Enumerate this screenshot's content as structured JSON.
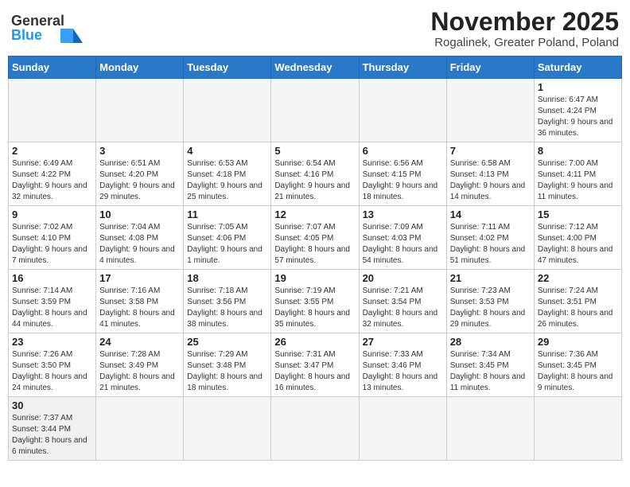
{
  "header": {
    "logo_general": "General",
    "logo_blue": "Blue",
    "month_title": "November 2025",
    "location": "Rogalinek, Greater Poland, Poland"
  },
  "days_of_week": [
    "Sunday",
    "Monday",
    "Tuesday",
    "Wednesday",
    "Thursday",
    "Friday",
    "Saturday"
  ],
  "weeks": [
    [
      {
        "day": "",
        "info": ""
      },
      {
        "day": "",
        "info": ""
      },
      {
        "day": "",
        "info": ""
      },
      {
        "day": "",
        "info": ""
      },
      {
        "day": "",
        "info": ""
      },
      {
        "day": "",
        "info": ""
      },
      {
        "day": "1",
        "info": "Sunrise: 6:47 AM\nSunset: 4:24 PM\nDaylight: 9 hours\nand 36 minutes."
      }
    ],
    [
      {
        "day": "2",
        "info": "Sunrise: 6:49 AM\nSunset: 4:22 PM\nDaylight: 9 hours\nand 32 minutes."
      },
      {
        "day": "3",
        "info": "Sunrise: 6:51 AM\nSunset: 4:20 PM\nDaylight: 9 hours\nand 29 minutes."
      },
      {
        "day": "4",
        "info": "Sunrise: 6:53 AM\nSunset: 4:18 PM\nDaylight: 9 hours\nand 25 minutes."
      },
      {
        "day": "5",
        "info": "Sunrise: 6:54 AM\nSunset: 4:16 PM\nDaylight: 9 hours\nand 21 minutes."
      },
      {
        "day": "6",
        "info": "Sunrise: 6:56 AM\nSunset: 4:15 PM\nDaylight: 9 hours\nand 18 minutes."
      },
      {
        "day": "7",
        "info": "Sunrise: 6:58 AM\nSunset: 4:13 PM\nDaylight: 9 hours\nand 14 minutes."
      },
      {
        "day": "8",
        "info": "Sunrise: 7:00 AM\nSunset: 4:11 PM\nDaylight: 9 hours\nand 11 minutes."
      }
    ],
    [
      {
        "day": "9",
        "info": "Sunrise: 7:02 AM\nSunset: 4:10 PM\nDaylight: 9 hours\nand 7 minutes."
      },
      {
        "day": "10",
        "info": "Sunrise: 7:04 AM\nSunset: 4:08 PM\nDaylight: 9 hours\nand 4 minutes."
      },
      {
        "day": "11",
        "info": "Sunrise: 7:05 AM\nSunset: 4:06 PM\nDaylight: 9 hours\nand 1 minute."
      },
      {
        "day": "12",
        "info": "Sunrise: 7:07 AM\nSunset: 4:05 PM\nDaylight: 8 hours\nand 57 minutes."
      },
      {
        "day": "13",
        "info": "Sunrise: 7:09 AM\nSunset: 4:03 PM\nDaylight: 8 hours\nand 54 minutes."
      },
      {
        "day": "14",
        "info": "Sunrise: 7:11 AM\nSunset: 4:02 PM\nDaylight: 8 hours\nand 51 minutes."
      },
      {
        "day": "15",
        "info": "Sunrise: 7:12 AM\nSunset: 4:00 PM\nDaylight: 8 hours\nand 47 minutes."
      }
    ],
    [
      {
        "day": "16",
        "info": "Sunrise: 7:14 AM\nSunset: 3:59 PM\nDaylight: 8 hours\nand 44 minutes."
      },
      {
        "day": "17",
        "info": "Sunrise: 7:16 AM\nSunset: 3:58 PM\nDaylight: 8 hours\nand 41 minutes."
      },
      {
        "day": "18",
        "info": "Sunrise: 7:18 AM\nSunset: 3:56 PM\nDaylight: 8 hours\nand 38 minutes."
      },
      {
        "day": "19",
        "info": "Sunrise: 7:19 AM\nSunset: 3:55 PM\nDaylight: 8 hours\nand 35 minutes."
      },
      {
        "day": "20",
        "info": "Sunrise: 7:21 AM\nSunset: 3:54 PM\nDaylight: 8 hours\nand 32 minutes."
      },
      {
        "day": "21",
        "info": "Sunrise: 7:23 AM\nSunset: 3:53 PM\nDaylight: 8 hours\nand 29 minutes."
      },
      {
        "day": "22",
        "info": "Sunrise: 7:24 AM\nSunset: 3:51 PM\nDaylight: 8 hours\nand 26 minutes."
      }
    ],
    [
      {
        "day": "23",
        "info": "Sunrise: 7:26 AM\nSunset: 3:50 PM\nDaylight: 8 hours\nand 24 minutes."
      },
      {
        "day": "24",
        "info": "Sunrise: 7:28 AM\nSunset: 3:49 PM\nDaylight: 8 hours\nand 21 minutes."
      },
      {
        "day": "25",
        "info": "Sunrise: 7:29 AM\nSunset: 3:48 PM\nDaylight: 8 hours\nand 18 minutes."
      },
      {
        "day": "26",
        "info": "Sunrise: 7:31 AM\nSunset: 3:47 PM\nDaylight: 8 hours\nand 16 minutes."
      },
      {
        "day": "27",
        "info": "Sunrise: 7:33 AM\nSunset: 3:46 PM\nDaylight: 8 hours\nand 13 minutes."
      },
      {
        "day": "28",
        "info": "Sunrise: 7:34 AM\nSunset: 3:45 PM\nDaylight: 8 hours\nand 11 minutes."
      },
      {
        "day": "29",
        "info": "Sunrise: 7:36 AM\nSunset: 3:45 PM\nDaylight: 8 hours\nand 9 minutes."
      }
    ],
    [
      {
        "day": "30",
        "info": "Sunrise: 7:37 AM\nSunset: 3:44 PM\nDaylight: 8 hours\nand 6 minutes."
      },
      {
        "day": "",
        "info": ""
      },
      {
        "day": "",
        "info": ""
      },
      {
        "day": "",
        "info": ""
      },
      {
        "day": "",
        "info": ""
      },
      {
        "day": "",
        "info": ""
      },
      {
        "day": "",
        "info": ""
      }
    ]
  ]
}
